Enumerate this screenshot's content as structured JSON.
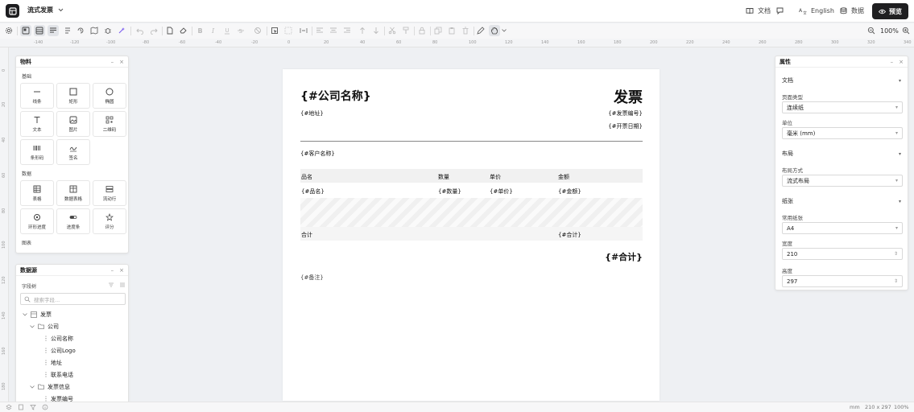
{
  "app": {
    "title": "流式发票"
  },
  "topbar": {
    "doc_label": "文档",
    "language_label": "English",
    "data_label": "数据",
    "preview_label": "预览"
  },
  "toolbar": {
    "zoom": "100%"
  },
  "ruler": {
    "h_labels": [
      "-140",
      "-120",
      "-100",
      "-80",
      "-60",
      "-40",
      "-20",
      "0",
      "20",
      "40",
      "60",
      "80",
      "100",
      "120",
      "140",
      "160",
      "180",
      "200",
      "220",
      "240",
      "260",
      "280",
      "300",
      "320",
      "340"
    ],
    "v_labels": [
      "0",
      "20",
      "40",
      "60",
      "80",
      "100",
      "120",
      "140",
      "160",
      "180",
      "200"
    ]
  },
  "materials": {
    "title": "物料",
    "basic_label": "基础",
    "basic_items": [
      "线条",
      "矩形",
      "椭圆",
      "文本",
      "图片",
      "二维码",
      "条形码",
      "签名"
    ],
    "data_label": "数据",
    "data_items": [
      "表格",
      "数据表格",
      "流动行",
      "环形进度",
      "进度条",
      "评分"
    ],
    "chart_label": "图表"
  },
  "datasource": {
    "title": "数据源",
    "fields_label": "字段树",
    "search_placeholder": "搜索字段...",
    "tree": {
      "root": "发票",
      "company": "公司",
      "company_name": "公司名称",
      "company_logo": "公司Logo",
      "address": "地址",
      "phone": "联系电话",
      "invoice_info": "发票信息",
      "invoice_no": "发票编号"
    }
  },
  "properties": {
    "title": "属性",
    "doc_section": "文档",
    "page_type_label": "页面类型",
    "page_type_value": "连续纸",
    "unit_label": "单位",
    "unit_value": "毫米 (mm)",
    "layout_section": "布局",
    "layout_mode_label": "布局方式",
    "layout_mode_value": "流式布局",
    "paper_section": "纸张",
    "paper_common_label": "常用纸张",
    "paper_common_value": "A4",
    "width_label": "宽度",
    "width_value": "210",
    "height_label": "高度",
    "height_value": "297"
  },
  "invoice": {
    "company_name": "{#公司名称}",
    "title": "发票",
    "address": "{#地址}",
    "invoice_no": "{#发票编号}",
    "date": "{#开票日期}",
    "customer": "{#客户名称}",
    "col_name": "品名",
    "col_qty": "数量",
    "col_price": "单价",
    "col_amount": "金额",
    "row_name": "{#品名}",
    "row_qty": "{#数量}",
    "row_price": "{#单价}",
    "row_amount": "{#金额}",
    "total_label": "合计",
    "total_value": "{#合计}",
    "grand_total": "{#合计}",
    "remark": "{#备注}"
  },
  "statusbar": {
    "unit": "mm",
    "size": "210 x 297",
    "zoom": "100%"
  }
}
